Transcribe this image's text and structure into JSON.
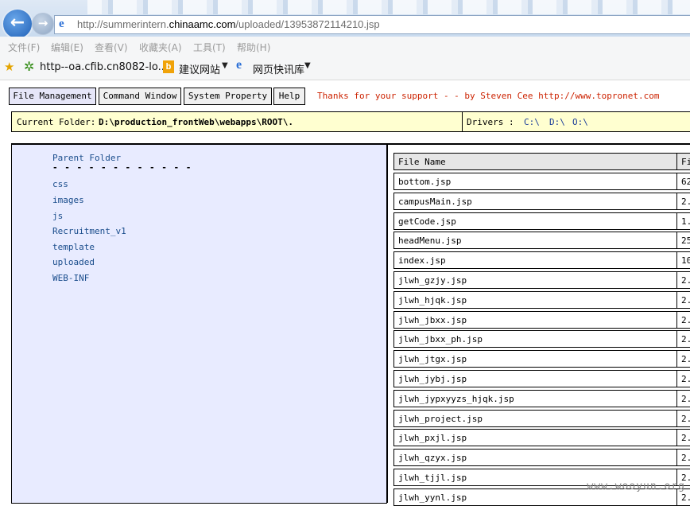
{
  "browser": {
    "url_prefix": "http://summerintern.",
    "url_domain": "chinaamc.com",
    "url_suffix": "/uploaded/13953872114210.jsp",
    "menu": [
      "文件(F)",
      "编辑(E)",
      "查看(V)",
      "收藏夹(A)",
      "工具(T)",
      "帮助(H)"
    ],
    "favorites": {
      "item1": "http--oa.cfib.cn8082-lo...",
      "item2": "建议网站",
      "item3": "网页快讯库",
      "bing_letter": "b",
      "ie_letter": "e"
    },
    "back_icon_glyph": "←",
    "forward_icon_glyph": "→"
  },
  "toolbar": {
    "buttons": [
      "File Management",
      "Command Window",
      "System Property",
      "Help"
    ],
    "thanks": "Thanks for your support - - by Steven Cee http://www.topronet.com"
  },
  "folder_bar": {
    "current_label": "Current Folder:",
    "current_value": "D:\\production_frontWeb\\webapps\\ROOT\\.",
    "drivers_label": "Drivers :",
    "drives": [
      "C:\\",
      "D:\\",
      "O:\\"
    ]
  },
  "tree": {
    "parent": "Parent Folder",
    "dashes": "- - - - - - - - - - - -",
    "folders": [
      "css",
      "images",
      "js",
      "Recruitment_v1",
      "template",
      "uploaded",
      "WEB-INF"
    ]
  },
  "files": {
    "headers": [
      "File Name",
      "Fi"
    ],
    "rows": [
      {
        "name": "bottom.jsp",
        "size": "62"
      },
      {
        "name": "campusMain.jsp",
        "size": "2."
      },
      {
        "name": "getCode.jsp",
        "size": "1."
      },
      {
        "name": "headMenu.jsp",
        "size": "25"
      },
      {
        "name": "index.jsp",
        "size": "10"
      },
      {
        "name": "jlwh_gzjy.jsp",
        "size": "2."
      },
      {
        "name": "jlwh_hjqk.jsp",
        "size": "2."
      },
      {
        "name": "jlwh_jbxx.jsp",
        "size": "2."
      },
      {
        "name": "jlwh_jbxx_ph.jsp",
        "size": "2."
      },
      {
        "name": "jlwh_jtgx.jsp",
        "size": "2."
      },
      {
        "name": "jlwh_jybj.jsp",
        "size": "2."
      },
      {
        "name": "jlwh_jypxyyzs_hjqk.jsp",
        "size": "2."
      },
      {
        "name": "jlwh_project.jsp",
        "size": "2."
      },
      {
        "name": "jlwh_pxjl.jsp",
        "size": "2."
      },
      {
        "name": "jlwh_qzyx.jsp",
        "size": "2."
      },
      {
        "name": "jlwh_tjjl.jsp",
        "size": "2."
      },
      {
        "name": "jlwh_yynl.jsp",
        "size": "2."
      }
    ]
  },
  "watermark": "www.wooyun.org"
}
